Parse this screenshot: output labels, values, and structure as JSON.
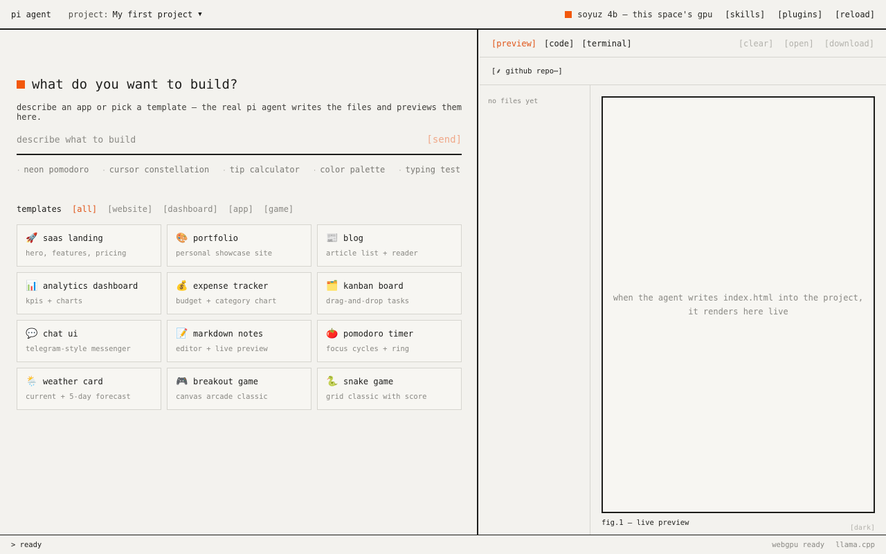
{
  "header": {
    "brand": "pi agent",
    "project_label": "project:",
    "project_name": "My first project",
    "caret": "▼",
    "model": "soyuz 4b — this space's gpu",
    "links": [
      "[skills]",
      "[plugins]",
      "[reload]"
    ],
    "accent": "#f2580c"
  },
  "hero": {
    "title": "what do you want to build?",
    "subtitle": "describe an app or pick a template — the real pi agent writes the files and previews them here.",
    "input_placeholder": "describe what to build",
    "input_value": "",
    "send_label": "[send]"
  },
  "suggestions": [
    "neon pomodoro",
    "cursor constellation",
    "tip calculator",
    "color palette",
    "typing test"
  ],
  "templates": {
    "label": "templates",
    "filters": [
      {
        "label": "[all]",
        "active": true
      },
      {
        "label": "[website]",
        "active": false
      },
      {
        "label": "[dashboard]",
        "active": false
      },
      {
        "label": "[app]",
        "active": false
      },
      {
        "label": "[game]",
        "active": false
      }
    ],
    "cards": [
      {
        "emoji": "🚀",
        "icon": "rocket-icon",
        "name": "saas landing",
        "desc": "hero, features, pricing"
      },
      {
        "emoji": "🎨",
        "icon": "palette-icon",
        "name": "portfolio",
        "desc": "personal showcase site"
      },
      {
        "emoji": "📰",
        "icon": "newspaper-icon",
        "name": "blog",
        "desc": "article list + reader"
      },
      {
        "emoji": "📊",
        "icon": "bar-chart-icon",
        "name": "analytics dashboard",
        "desc": "kpis + charts"
      },
      {
        "emoji": "💰",
        "icon": "money-bag-icon",
        "name": "expense tracker",
        "desc": "budget + category chart"
      },
      {
        "emoji": "🗂️",
        "icon": "card-index-icon",
        "name": "kanban board",
        "desc": "drag-and-drop tasks"
      },
      {
        "emoji": "💬",
        "icon": "speech-bubble-icon",
        "name": "chat ui",
        "desc": "telegram-style messenger"
      },
      {
        "emoji": "📝",
        "icon": "memo-icon",
        "name": "markdown notes",
        "desc": "editor + live preview"
      },
      {
        "emoji": "🍅",
        "icon": "tomato-icon",
        "name": "pomodoro timer",
        "desc": "focus cycles + ring"
      },
      {
        "emoji": "🌦️",
        "icon": "weather-icon",
        "name": "weather card",
        "desc": "current + 5-day forecast"
      },
      {
        "emoji": "🎮",
        "icon": "gamepad-icon",
        "name": "breakout game",
        "desc": "canvas arcade classic"
      },
      {
        "emoji": "🐍",
        "icon": "snake-icon",
        "name": "snake game",
        "desc": "grid classic with score"
      }
    ]
  },
  "right_panel": {
    "tabs": [
      {
        "label": "[preview]",
        "active": true
      },
      {
        "label": "[code]",
        "active": false
      },
      {
        "label": "[terminal]",
        "active": false
      }
    ],
    "actions": [
      "[clear]",
      "[open]",
      "[download]"
    ],
    "repo_button": "[⸙ github repo⋯]",
    "files_empty": "no files yet",
    "preview_message_line1": "when the agent writes index.html into the project,",
    "preview_message_line2": "it renders here live",
    "caption": "fig.1 — live preview",
    "dark_toggle": "[dark]"
  },
  "status": {
    "text": "> ready",
    "right": [
      "webgpu ready",
      "llama.cpp"
    ]
  }
}
